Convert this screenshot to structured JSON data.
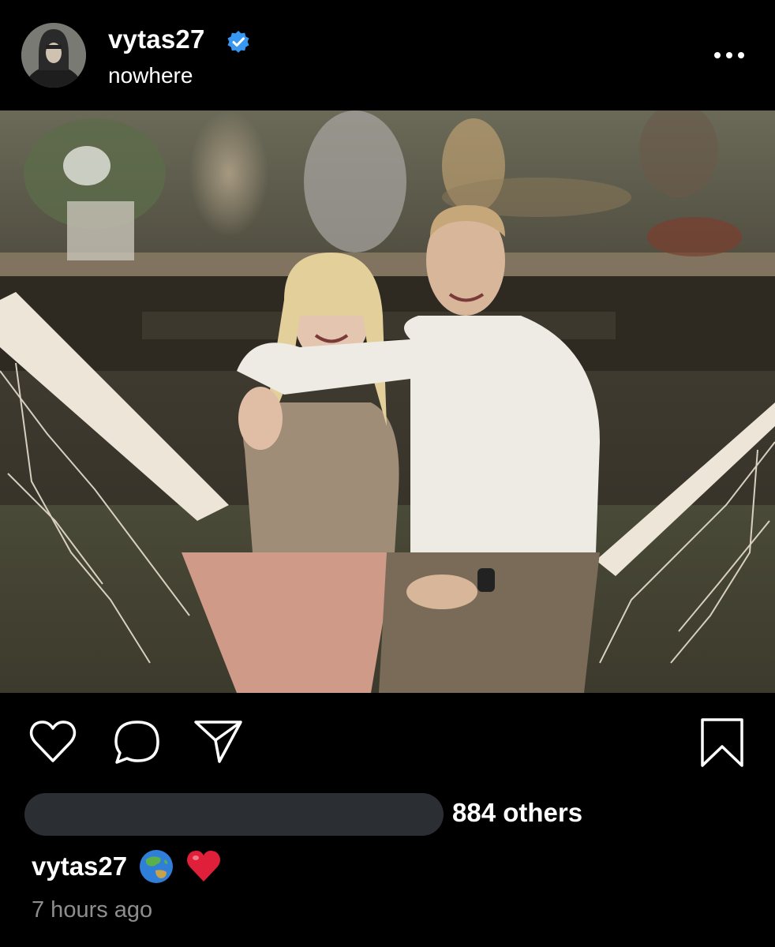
{
  "post": {
    "username": "vytas27",
    "location": "nowhere",
    "verified": true,
    "likes_suffix": "884 others",
    "caption_user": "vytas27",
    "caption_emojis": [
      "globe-asia-australia-emoji",
      "red-heart-emoji"
    ],
    "timestamp": "7 hours ago"
  },
  "icons": {
    "more": "more-horizontal-icon",
    "like": "heart-outline-icon",
    "comment": "comment-bubble-icon",
    "share": "paper-plane-icon",
    "save": "bookmark-outline-icon"
  },
  "colors": {
    "background": "#000000",
    "verified_badge": "#3897f0",
    "timestamp": "#8e8e8e",
    "redaction": "#2b2e33",
    "heart_emoji": "#e0203a"
  }
}
